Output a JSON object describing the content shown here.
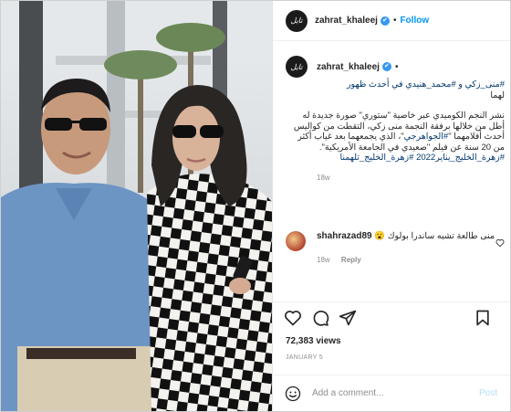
{
  "post": {
    "username": "zahrat_khaleej",
    "avatar_text": "تايل",
    "follow_label": "Follow",
    "dot": "•",
    "caption": {
      "line1_prefix": "منى_زكي و #محمد_هنيدي في أحدث ظهور",
      "line1_tag": "#",
      "line2": "لهما",
      "para2": "نشر النجم الكوميدي عبر خاصية \"ستوري\" صورة جديدة له أطل من خلالها برفقة النجمة منى زكي، التقطت من كواليس أحدث أفلامهما \"",
      "para2_tag": "#الجواهرجي",
      "para2_end": "\"، الذي يجمعهما بعد غياب أكثر من 20 سنة عن فيلم \"صعيدي في الجامعة الأمريكية\".",
      "hashtags": "#زهرة_الخليج_يناير2022 #زهرة_الخليج_تلهمنا"
    },
    "caption_age": "18w",
    "comment": {
      "username": "shahrazad89",
      "text": "منى طالعة تشبه ساندرا بولوك 😮",
      "age": "18w",
      "reply_label": "Reply"
    },
    "views": "72,383 views",
    "date": "JANUARY 5",
    "add_comment_placeholder": "Add a comment...",
    "post_label": "Post"
  },
  "icons": {
    "verified": "✔"
  },
  "colors": {
    "accent": "#0095f6",
    "verified": "#3897f0",
    "link": "#00376b"
  }
}
